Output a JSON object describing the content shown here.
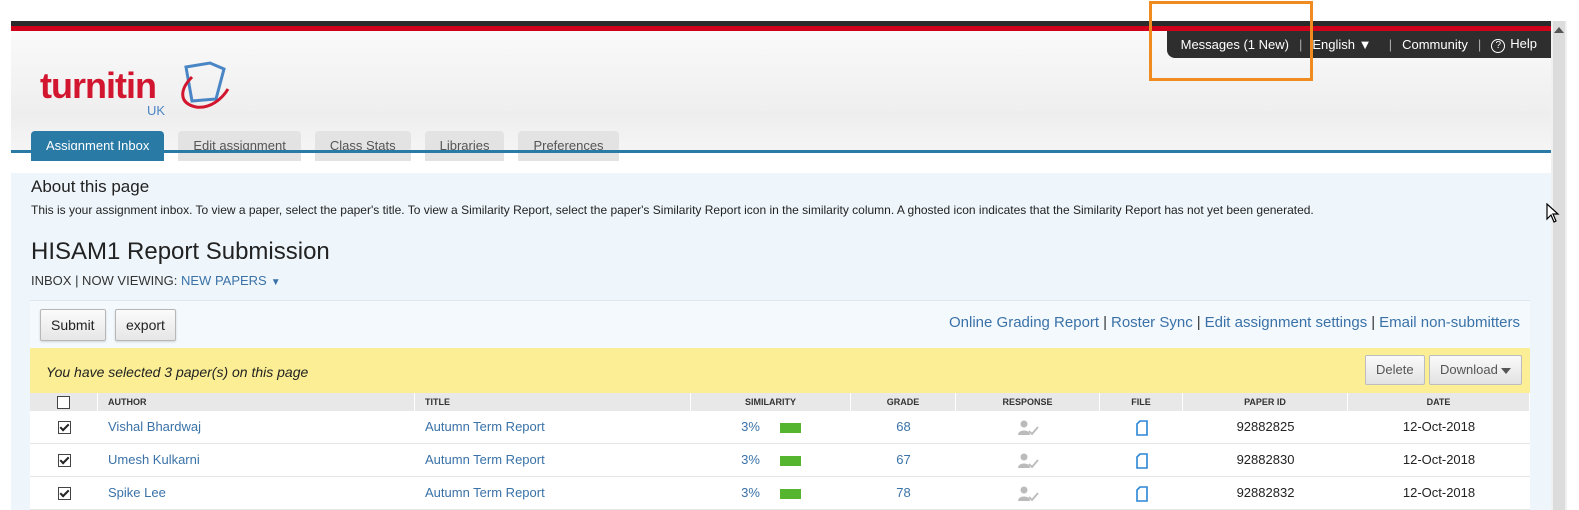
{
  "utility_nav": {
    "messages": "Messages (1 New)",
    "language": "English ▼",
    "community": "Community",
    "help": "Help"
  },
  "logo": {
    "word": "turnitin",
    "region": "UK"
  },
  "tabs": [
    {
      "label": "Assignment Inbox",
      "active": true
    },
    {
      "label": "Edit assignment",
      "active": false
    },
    {
      "label": "Class Stats",
      "active": false
    },
    {
      "label": "Libraries",
      "active": false
    },
    {
      "label": "Preferences",
      "active": false
    }
  ],
  "about": {
    "title": "About this page",
    "text": "This is your assignment inbox. To view a paper, select the paper's title. To view a Similarity Report, select the paper's Similarity Report icon in the similarity column. A ghosted icon indicates that the Similarity Report has not yet been generated."
  },
  "assignment": {
    "title": "HISAM1 Report Submission",
    "viewing_prefix": "INBOX | NOW VIEWING: ",
    "viewing_value": "NEW PAPERS"
  },
  "toolbar": {
    "submit": "Submit",
    "export": "export",
    "links": [
      "Online Grading Report",
      "Roster Sync",
      "Edit assignment settings",
      "Email non-submitters"
    ]
  },
  "selection": {
    "message": "You have selected 3 paper(s) on this page",
    "delete": "Delete",
    "download": "Download"
  },
  "table": {
    "headers": [
      "Author",
      "Title",
      "Similarity",
      "Grade",
      "Response",
      "File",
      "Paper ID",
      "Date"
    ],
    "rows": [
      {
        "checked": true,
        "author": "Vishal Bhardwaj",
        "title": "Autumn Term Report",
        "similarity": "3%",
        "grade": "68",
        "paper_id": "92882825",
        "date": "12-Oct-2018"
      },
      {
        "checked": true,
        "author": "Umesh Kulkarni",
        "title": "Autumn Term Report",
        "similarity": "3%",
        "grade": "67",
        "paper_id": "92882830",
        "date": "12-Oct-2018"
      },
      {
        "checked": true,
        "author": "Spike Lee",
        "title": "Autumn Term Report",
        "similarity": "3%",
        "grade": "78",
        "paper_id": "92882832",
        "date": "12-Oct-2018"
      }
    ]
  },
  "colors": {
    "brand_red": "#d2162f",
    "tab_active": "#2a7aa6",
    "link": "#3a72a8",
    "similarity_green": "#56b52e",
    "selection_bar": "#fbee94",
    "highlight_box": "#f08c1f"
  }
}
